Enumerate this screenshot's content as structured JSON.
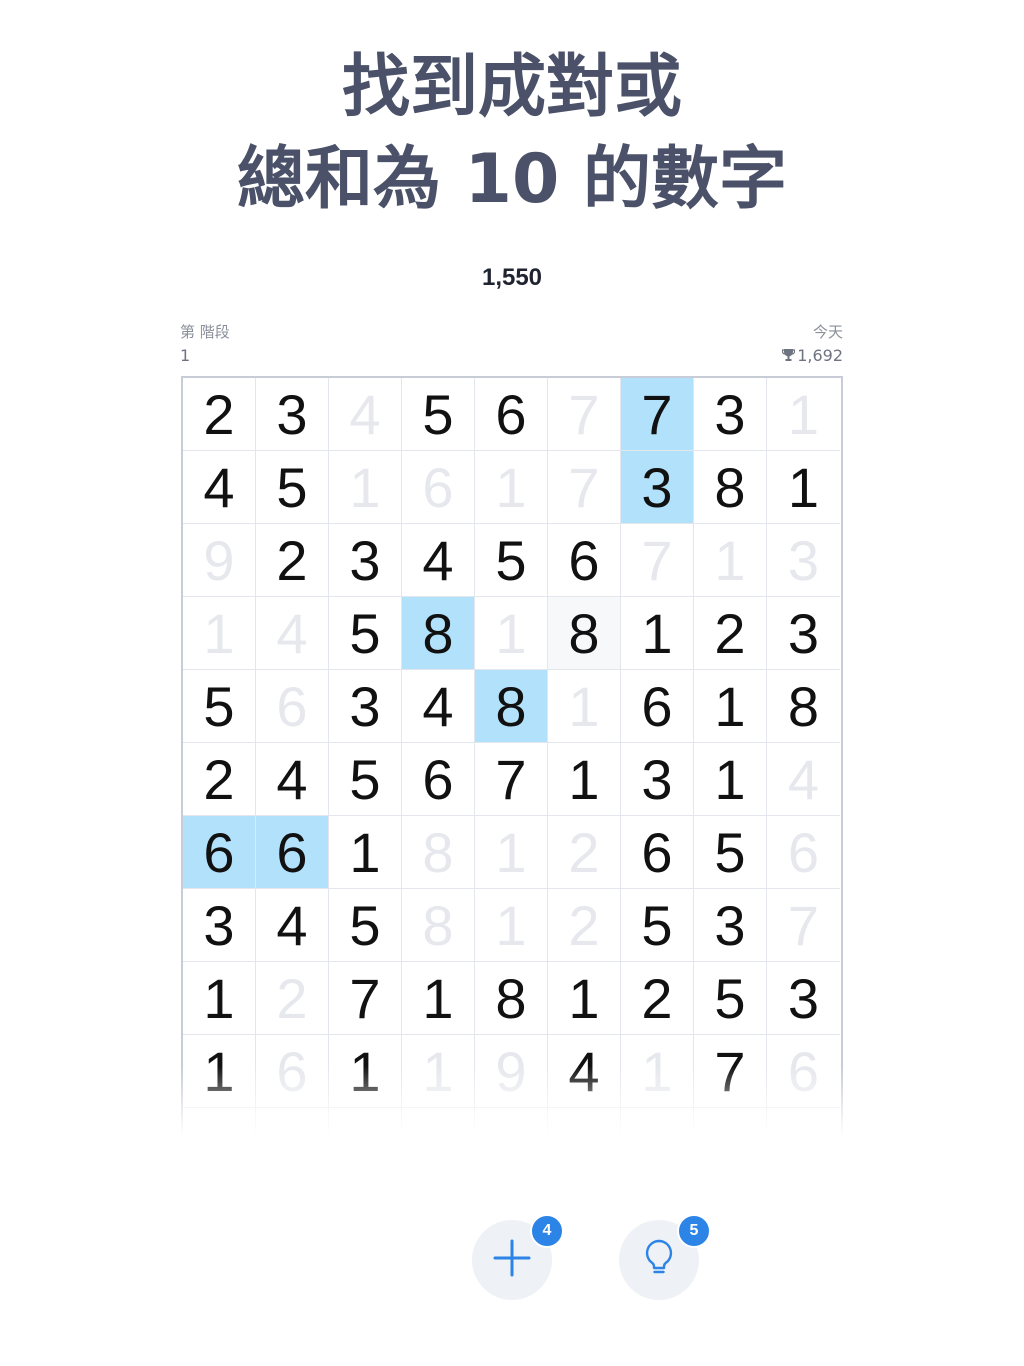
{
  "headline": {
    "line1": "找到成對或",
    "line2": "總和為 10 的數字"
  },
  "score": "1,550",
  "stage": {
    "label": "第 階段",
    "value": "1"
  },
  "today": {
    "label": "今天",
    "best": "1,692",
    "icon": "trophy-icon"
  },
  "board": {
    "rows": [
      [
        {
          "v": "2",
          "s": "active"
        },
        {
          "v": "3",
          "s": "active"
        },
        {
          "v": "4",
          "s": "faded"
        },
        {
          "v": "5",
          "s": "active"
        },
        {
          "v": "6",
          "s": "active"
        },
        {
          "v": "7",
          "s": "faded"
        },
        {
          "v": "7",
          "s": "selected"
        },
        {
          "v": "3",
          "s": "active"
        },
        {
          "v": "1",
          "s": "faded"
        }
      ],
      [
        {
          "v": "4",
          "s": "active"
        },
        {
          "v": "5",
          "s": "active"
        },
        {
          "v": "1",
          "s": "faded"
        },
        {
          "v": "6",
          "s": "faded"
        },
        {
          "v": "1",
          "s": "faded"
        },
        {
          "v": "7",
          "s": "faded"
        },
        {
          "v": "3",
          "s": "selected"
        },
        {
          "v": "8",
          "s": "active"
        },
        {
          "v": "1",
          "s": "active"
        }
      ],
      [
        {
          "v": "9",
          "s": "faded"
        },
        {
          "v": "2",
          "s": "active"
        },
        {
          "v": "3",
          "s": "active"
        },
        {
          "v": "4",
          "s": "active"
        },
        {
          "v": "5",
          "s": "active"
        },
        {
          "v": "6",
          "s": "active"
        },
        {
          "v": "7",
          "s": "faded"
        },
        {
          "v": "1",
          "s": "faded"
        },
        {
          "v": "3",
          "s": "faded"
        }
      ],
      [
        {
          "v": "1",
          "s": "faded"
        },
        {
          "v": "4",
          "s": "faded"
        },
        {
          "v": "5",
          "s": "active"
        },
        {
          "v": "8",
          "s": "selected"
        },
        {
          "v": "1",
          "s": "faded"
        },
        {
          "v": "8",
          "s": "hint"
        },
        {
          "v": "1",
          "s": "active"
        },
        {
          "v": "2",
          "s": "active"
        },
        {
          "v": "3",
          "s": "active"
        }
      ],
      [
        {
          "v": "5",
          "s": "active"
        },
        {
          "v": "6",
          "s": "faded"
        },
        {
          "v": "3",
          "s": "active"
        },
        {
          "v": "4",
          "s": "active"
        },
        {
          "v": "8",
          "s": "selected"
        },
        {
          "v": "1",
          "s": "faded"
        },
        {
          "v": "6",
          "s": "active"
        },
        {
          "v": "1",
          "s": "active"
        },
        {
          "v": "8",
          "s": "active"
        }
      ],
      [
        {
          "v": "2",
          "s": "active"
        },
        {
          "v": "4",
          "s": "active"
        },
        {
          "v": "5",
          "s": "active"
        },
        {
          "v": "6",
          "s": "active"
        },
        {
          "v": "7",
          "s": "active"
        },
        {
          "v": "1",
          "s": "active"
        },
        {
          "v": "3",
          "s": "active"
        },
        {
          "v": "1",
          "s": "active"
        },
        {
          "v": "4",
          "s": "faded"
        }
      ],
      [
        {
          "v": "6",
          "s": "selected"
        },
        {
          "v": "6",
          "s": "selected"
        },
        {
          "v": "1",
          "s": "active"
        },
        {
          "v": "8",
          "s": "faded"
        },
        {
          "v": "1",
          "s": "faded"
        },
        {
          "v": "2",
          "s": "faded"
        },
        {
          "v": "6",
          "s": "active"
        },
        {
          "v": "5",
          "s": "active"
        },
        {
          "v": "6",
          "s": "faded"
        }
      ],
      [
        {
          "v": "3",
          "s": "active"
        },
        {
          "v": "4",
          "s": "active"
        },
        {
          "v": "5",
          "s": "active"
        },
        {
          "v": "8",
          "s": "faded"
        },
        {
          "v": "1",
          "s": "faded"
        },
        {
          "v": "2",
          "s": "faded"
        },
        {
          "v": "5",
          "s": "active"
        },
        {
          "v": "3",
          "s": "active"
        },
        {
          "v": "7",
          "s": "faded"
        }
      ],
      [
        {
          "v": "1",
          "s": "active"
        },
        {
          "v": "2",
          "s": "faded"
        },
        {
          "v": "7",
          "s": "active"
        },
        {
          "v": "1",
          "s": "active"
        },
        {
          "v": "8",
          "s": "active"
        },
        {
          "v": "1",
          "s": "active"
        },
        {
          "v": "2",
          "s": "active"
        },
        {
          "v": "5",
          "s": "active"
        },
        {
          "v": "3",
          "s": "active"
        }
      ],
      [
        {
          "v": "1",
          "s": "active"
        },
        {
          "v": "6",
          "s": "faded"
        },
        {
          "v": "1",
          "s": "active"
        },
        {
          "v": "1",
          "s": "faded"
        },
        {
          "v": "9",
          "s": "faded"
        },
        {
          "v": "4",
          "s": "active"
        },
        {
          "v": "1",
          "s": "faded"
        },
        {
          "v": "7",
          "s": "active"
        },
        {
          "v": "6",
          "s": "faded"
        }
      ],
      [
        {
          "v": "",
          "s": "active"
        },
        {
          "v": "",
          "s": "active"
        },
        {
          "v": "",
          "s": "active"
        },
        {
          "v": "",
          "s": "active"
        },
        {
          "v": "",
          "s": "active"
        },
        {
          "v": "",
          "s": "active"
        },
        {
          "v": "",
          "s": "active"
        },
        {
          "v": "",
          "s": "active"
        },
        {
          "v": "",
          "s": "active"
        }
      ]
    ]
  },
  "actions": {
    "add": {
      "icon": "plus-icon",
      "badge": "4"
    },
    "hint": {
      "icon": "lightbulb-icon",
      "badge": "5"
    }
  },
  "colors": {
    "selected": "#b2e1fb",
    "badge": "#2b84e6",
    "headline": "#4a5168"
  }
}
